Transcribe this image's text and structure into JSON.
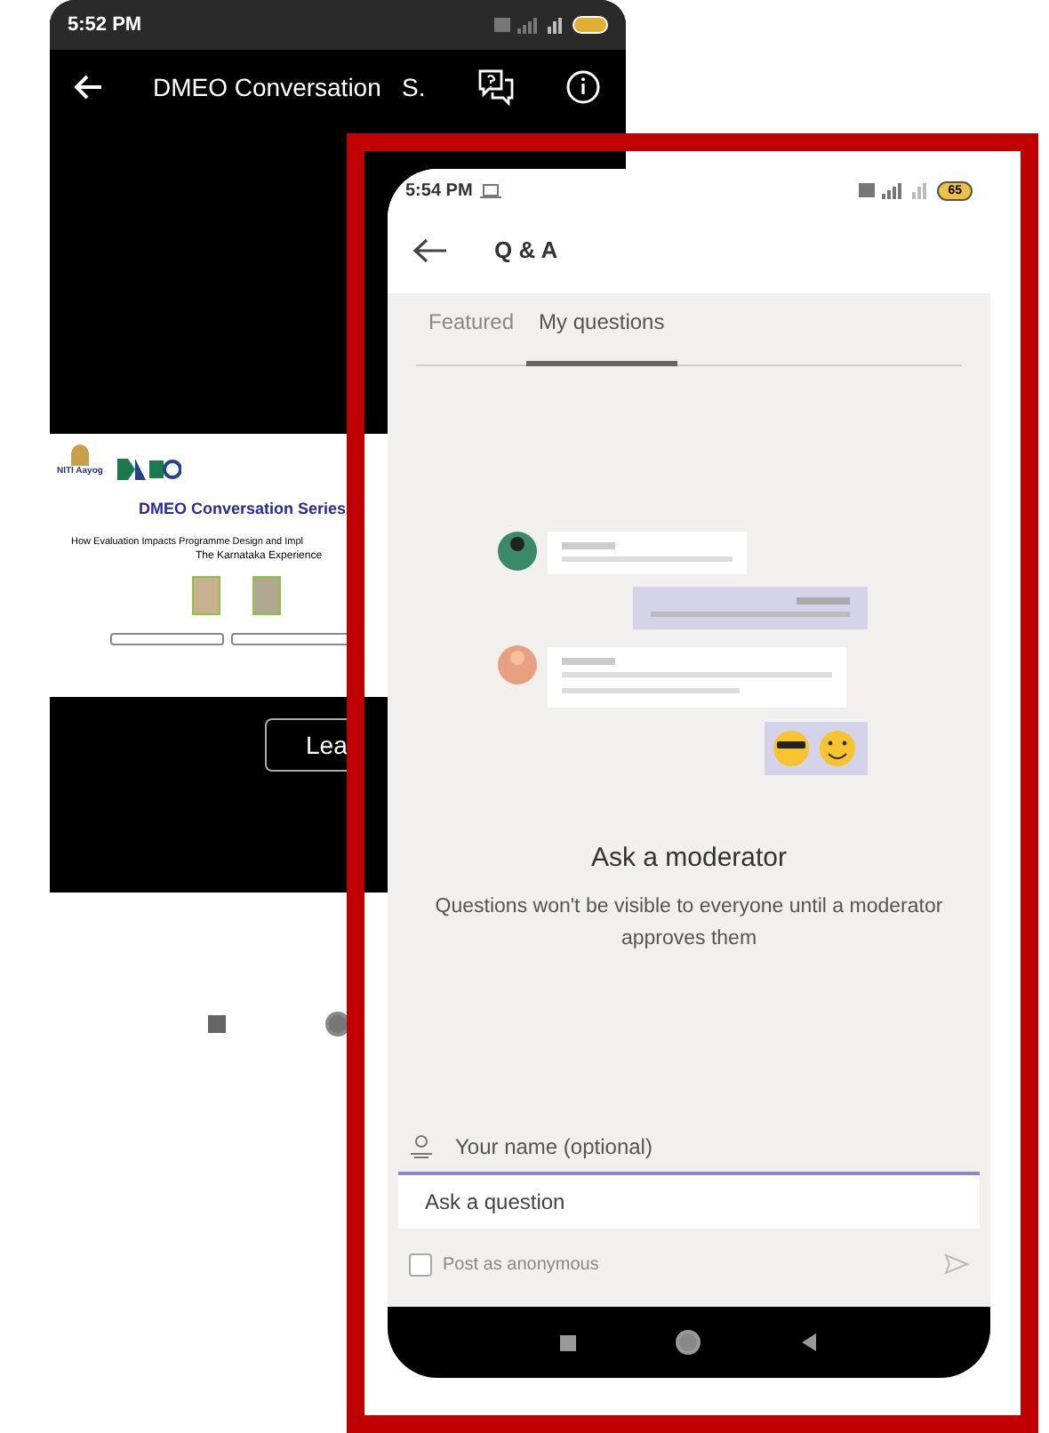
{
  "back_phone": {
    "status_bar": {
      "time": "5:52 PM"
    },
    "header": {
      "title": "DMEO Conversation   S."
    },
    "slide": {
      "logo_caption": "NITI Aayog",
      "title": "DMEO Conversation Series",
      "subtitle": "How Evaluation Impacts Programme Design and Impl",
      "subtitle_line_2": "The Karnataka Experience"
    },
    "leave_button": "Lea"
  },
  "front_phone": {
    "status_bar": {
      "time": "5:54 PM",
      "battery": "65"
    },
    "header": {
      "title": "Q & A"
    },
    "tabs": [
      {
        "label": "Featured",
        "selected": false
      },
      {
        "label": "My questions",
        "selected": true
      }
    ],
    "empty_state": {
      "title": "Ask a moderator",
      "text": "Questions won't be visible to everyone until a moderator approves them"
    },
    "name_field": {
      "placeholder": "Your name (optional)"
    },
    "question_field": {
      "placeholder": "Ask a question"
    },
    "anonymous": {
      "label": "Post as anonymous",
      "checked": false
    }
  }
}
